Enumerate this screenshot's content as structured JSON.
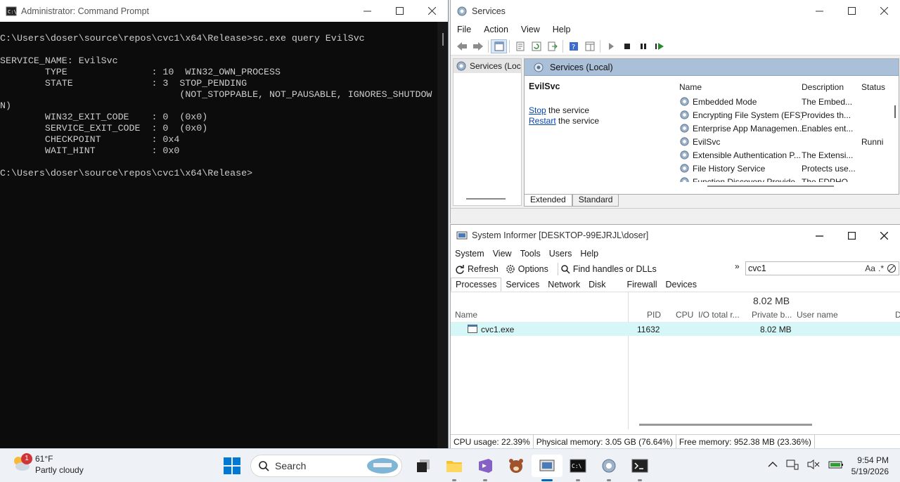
{
  "cmd": {
    "title": "Administrator: Command Prompt",
    "lines": [
      "C:\\Users\\doser\\source\\repos\\cvc1\\x64\\Release>sc.exe query EvilSvc",
      "",
      "SERVICE_NAME: EvilSvc",
      "        TYPE               : 10  WIN32_OWN_PROCESS",
      "        STATE              : 3  STOP_PENDING",
      "                                (NOT_STOPPABLE, NOT_PAUSABLE, IGNORES_SHUTDOW",
      "N)",
      "        WIN32_EXIT_CODE    : 0  (0x0)",
      "        SERVICE_EXIT_CODE  : 0  (0x0)",
      "        CHECKPOINT         : 0x4",
      "        WAIT_HINT          : 0x0",
      "",
      "C:\\Users\\doser\\source\\repos\\cvc1\\x64\\Release>"
    ]
  },
  "services": {
    "title": "Services",
    "menu": [
      "File",
      "Action",
      "View",
      "Help"
    ],
    "tree_node": "Services (Local)",
    "pane_title": "Services (Local)",
    "selected_service": "EvilSvc",
    "stop_link": "Stop",
    "stop_rest": " the service",
    "restart_link": "Restart",
    "restart_rest": " the service",
    "columns": {
      "name": "Name",
      "description": "Description",
      "status": "Status"
    },
    "rows": [
      {
        "name": "Embedded Mode",
        "description": "The Embed...",
        "status": ""
      },
      {
        "name": "Encrypting File System (EFS)",
        "description": "Provides th...",
        "status": ""
      },
      {
        "name": "Enterprise App Managemen...",
        "description": "Enables ent...",
        "status": ""
      },
      {
        "name": "EvilSvc",
        "description": "",
        "status": "Runni"
      },
      {
        "name": "Extensible Authentication P...",
        "description": "The Extensi...",
        "status": ""
      },
      {
        "name": "File History Service",
        "description": "Protects use...",
        "status": ""
      },
      {
        "name": "Function Discovery Provide...",
        "description": "The FDPHO...",
        "status": ""
      }
    ],
    "tabs": [
      "Extended",
      "Standard"
    ]
  },
  "sysinformer": {
    "title": "System Informer [DESKTOP-99EJRJL\\doser]",
    "menu": [
      "System",
      "View",
      "Tools",
      "Users",
      "Help"
    ],
    "refresh": "Refresh",
    "options": "Options",
    "find": "Find handles or DLLs",
    "search_value": "cvc1",
    "search_opt1": "Aa",
    "search_opt2": ".*",
    "tabs": [
      "Processes",
      "Services",
      "Network",
      "Disk",
      "Firewall",
      "Devices"
    ],
    "columns": {
      "name": "Name",
      "pid": "PID",
      "cpu": "CPU",
      "io": "I/O total r...",
      "private_total": "8.02 MB",
      "private": "Private b...",
      "user": "User name",
      "extra": "D"
    },
    "process": {
      "name": "cvc1.exe",
      "pid": "11632",
      "private": "8.02 MB"
    },
    "status": {
      "cpu": "CPU usage: 22.39%",
      "phys": "Physical memory: 3.05 GB (76.64%)",
      "free": "Free memory: 952.38 MB (23.36%)"
    }
  },
  "taskbar": {
    "temp": "61°F",
    "condition": "Partly cloudy",
    "badge": "1",
    "search_placeholder": "Search",
    "time": "9:54 PM",
    "date": "5/19/2026"
  }
}
